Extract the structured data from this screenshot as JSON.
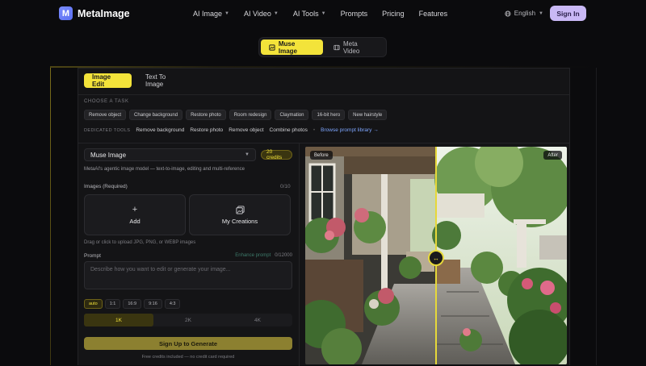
{
  "brand": {
    "name": "MetaImage",
    "badge": "M"
  },
  "nav": {
    "items": [
      {
        "label": "AI Image",
        "dropdown": true
      },
      {
        "label": "AI Video",
        "dropdown": true
      },
      {
        "label": "AI Tools",
        "dropdown": true
      },
      {
        "label": "Prompts",
        "dropdown": false
      },
      {
        "label": "Pricing",
        "dropdown": false
      },
      {
        "label": "Features",
        "dropdown": false
      }
    ],
    "language": "English",
    "sign_in": "Sign In"
  },
  "mode_switch": {
    "active": "Muse Image",
    "other": "Meta Video"
  },
  "tabs": {
    "active": "Image Edit",
    "other": "Text To Image"
  },
  "tasks": {
    "caption": "CHOOSE A TASK",
    "chips": [
      "Remove object",
      "Change background",
      "Restore photo",
      "Room redesign",
      "Claymation",
      "16-bit hero",
      "New hairstyle"
    ]
  },
  "tools": {
    "caption": "DEDICATED TOOLS",
    "links": [
      "Remove background",
      "Restore photo",
      "Remove object",
      "Combine photos"
    ],
    "browse": "Browse prompt library →"
  },
  "model": {
    "selected": "Muse Image",
    "credits": "20 credits",
    "description": "MetaAI's agentic image model — text-to-image, editing and multi-reference"
  },
  "images": {
    "label": "Images (Required)",
    "count": "0/10",
    "add": "Add",
    "my_creations": "My Creations",
    "hint": "Drag or click to upload JPG, PNG, or WEBP images"
  },
  "prompt": {
    "label": "Prompt",
    "enhance": "Enhance prompt",
    "char_count": "0/12000",
    "placeholder": "Describe how you want to edit or generate your image..."
  },
  "ratios": {
    "options": [
      "auto",
      "1:1",
      "16:9",
      "9:16",
      "4:3"
    ],
    "selected": "auto"
  },
  "resolution": {
    "options": [
      "1K",
      "2K",
      "4K"
    ],
    "selected": "1K"
  },
  "generate": {
    "label": "Sign Up to Generate",
    "note": "Free credits included — no credit card required"
  },
  "compare": {
    "before": "Before",
    "after": "After",
    "split_percent": 50
  },
  "colors": {
    "accent": "#f3e33a",
    "signin": "#c9b8f5",
    "link": "#7ea6ff"
  },
  "icons": [
    "muse-image-icon",
    "video-icon",
    "globe-icon",
    "plus-icon",
    "gallery-icon",
    "chevron-down-icon",
    "compare-arrows-icon"
  ]
}
